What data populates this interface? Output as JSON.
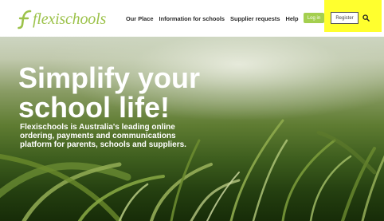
{
  "header": {
    "logo_text": "flexischools",
    "nav": [
      "Our Place",
      "Information for schools",
      "Supplier requests",
      "Help"
    ],
    "login_label": "Log in",
    "register_label": "Register",
    "search_icon": "search-icon",
    "colors": {
      "brand_green": "#9cc24a",
      "login_bg": "#a4cf4f",
      "highlight": "#ffff2e"
    }
  },
  "hero": {
    "title_line1": "Simplify your",
    "title_line2": "school life!",
    "description": "Flexischools is Australia's leading online ordering, payments and communications platform for parents, schools and suppliers."
  }
}
